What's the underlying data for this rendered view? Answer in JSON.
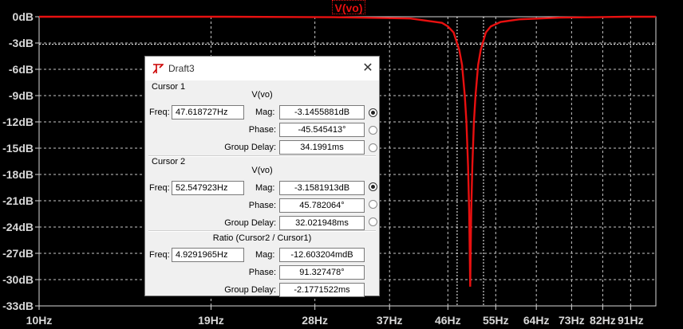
{
  "trace_title": "V(vo)",
  "colors": {
    "trace": "#e81010",
    "grid": "#c8c8c8",
    "background": "#000000"
  },
  "chart_data": {
    "type": "line",
    "title": "V(vo)",
    "x_scale": "log",
    "xlim": [
      10,
      100
    ],
    "ylim": [
      -33,
      0
    ],
    "y_unit": "dB",
    "x_ticks": [
      "10Hz",
      "19Hz",
      "28Hz",
      "37Hz",
      "46Hz",
      "55Hz",
      "64Hz",
      "73Hz",
      "82Hz",
      "91Hz"
    ],
    "y_ticks": [
      "0dB",
      "-3dB",
      "-6dB",
      "-9dB",
      "-12dB",
      "-15dB",
      "-18dB",
      "-21dB",
      "-24dB",
      "-27dB",
      "-30dB",
      "-33dB"
    ],
    "grid": true,
    "cursor_freqs": [
      47.618727,
      52.547923
    ],
    "cursor_level_db": -3.15,
    "series": [
      {
        "x": [
          10,
          20,
          30,
          40,
          45,
          46,
          47,
          48,
          48.5,
          49,
          49.3,
          49.6,
          49.8,
          50,
          50.2,
          50.4,
          50.7,
          51,
          51.5,
          52,
          53,
          54,
          56,
          60,
          70,
          80,
          90,
          100
        ],
        "y": [
          0,
          0,
          -0.05,
          -0.2,
          -0.7,
          -1.1,
          -1.8,
          -3.8,
          -5.5,
          -9,
          -12,
          -17,
          -22,
          -30.8,
          -22,
          -17,
          -12,
          -9,
          -5.5,
          -3.8,
          -1.8,
          -1.1,
          -0.6,
          -0.3,
          -0.1,
          -0.05,
          0,
          0
        ]
      }
    ]
  },
  "dialog": {
    "title": "Draft3",
    "close_glyph": "✕",
    "cursor1": {
      "section": "Cursor 1",
      "heading": "V(vo)",
      "freq_label": "Freq:",
      "freq": "47.618727Hz",
      "mag_label": "Mag:",
      "mag": "-3.1455881dB",
      "phase_label": "Phase:",
      "phase": "-45.545413°",
      "gd_label": "Group Delay:",
      "gd": "34.1991ms"
    },
    "cursor2": {
      "section": "Cursor 2",
      "heading": "V(vo)",
      "freq_label": "Freq:",
      "freq": "52.547923Hz",
      "mag_label": "Mag:",
      "mag": "-3.1581913dB",
      "phase_label": "Phase:",
      "phase": "45.782064°",
      "gd_label": "Group Delay:",
      "gd": "32.021948ms"
    },
    "ratio": {
      "heading": "Ratio (Cursor2 / Cursor1)",
      "freq_label": "Freq:",
      "freq": "4.9291965Hz",
      "mag_label": "Mag:",
      "mag": "-12.603204mdB",
      "phase_label": "Phase:",
      "phase": "91.327478°",
      "gd_label": "Group Delay:",
      "gd": "-2.1771522ms"
    }
  }
}
